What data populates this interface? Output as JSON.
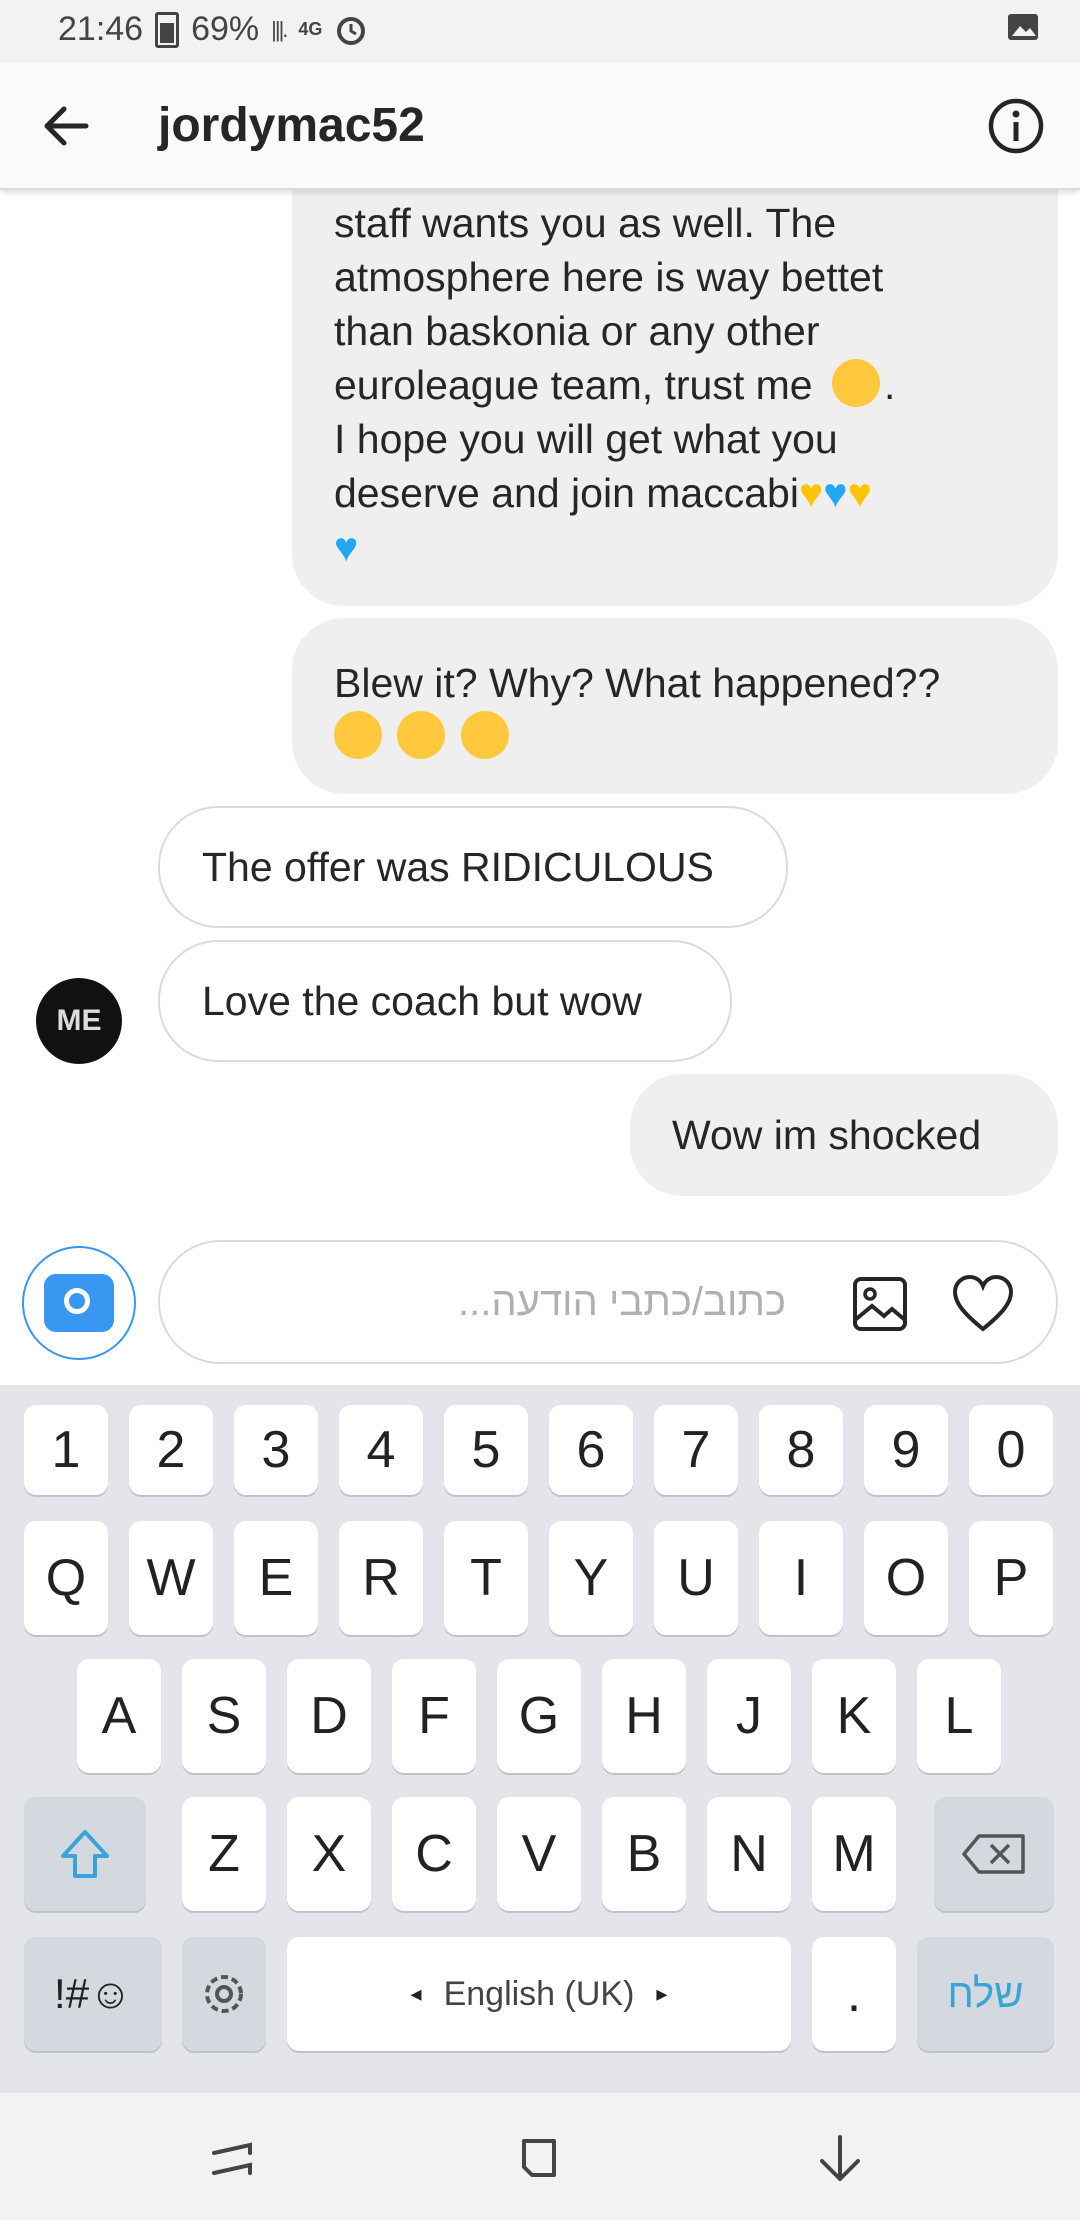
{
  "status_bar": {
    "time": "21:46",
    "battery": "69%",
    "network": "4G"
  },
  "header": {
    "title": "jordymac52"
  },
  "messages": {
    "m1_lines": [
      "staff wants you as well. The",
      "atmosphere here is way bettet",
      "than baskonia or any other",
      "euroleague team, trust me",
      "I hope you will get what you",
      "deserve and join maccabi"
    ],
    "m2_line1": "Blew it? Why? What happened??",
    "m3": "The offer was RIDICULOUS",
    "m4": "Love the coach but wow",
    "m5": "Wow im shocked"
  },
  "composer": {
    "placeholder": "כתוב/כתבי הודעה..."
  },
  "keyboard": {
    "row_numbers": [
      "1",
      "2",
      "3",
      "4",
      "5",
      "6",
      "7",
      "8",
      "9",
      "0"
    ],
    "row_q": [
      "Q",
      "W",
      "E",
      "R",
      "T",
      "Y",
      "U",
      "I",
      "O",
      "P"
    ],
    "row_a": [
      "A",
      "S",
      "D",
      "F",
      "G",
      "H",
      "J",
      "K",
      "L"
    ],
    "row_z": [
      "Z",
      "X",
      "C",
      "V",
      "B",
      "N",
      "M"
    ],
    "symbols_label": "!#☺",
    "space_label": "English (UK)",
    "period_label": ".",
    "send_label": "שלח"
  },
  "colors": {
    "accent": "#3897f0",
    "bubble_out": "#efefef",
    "border": "#dbdbdb",
    "keyboard_bg": "#e3e5ea"
  }
}
